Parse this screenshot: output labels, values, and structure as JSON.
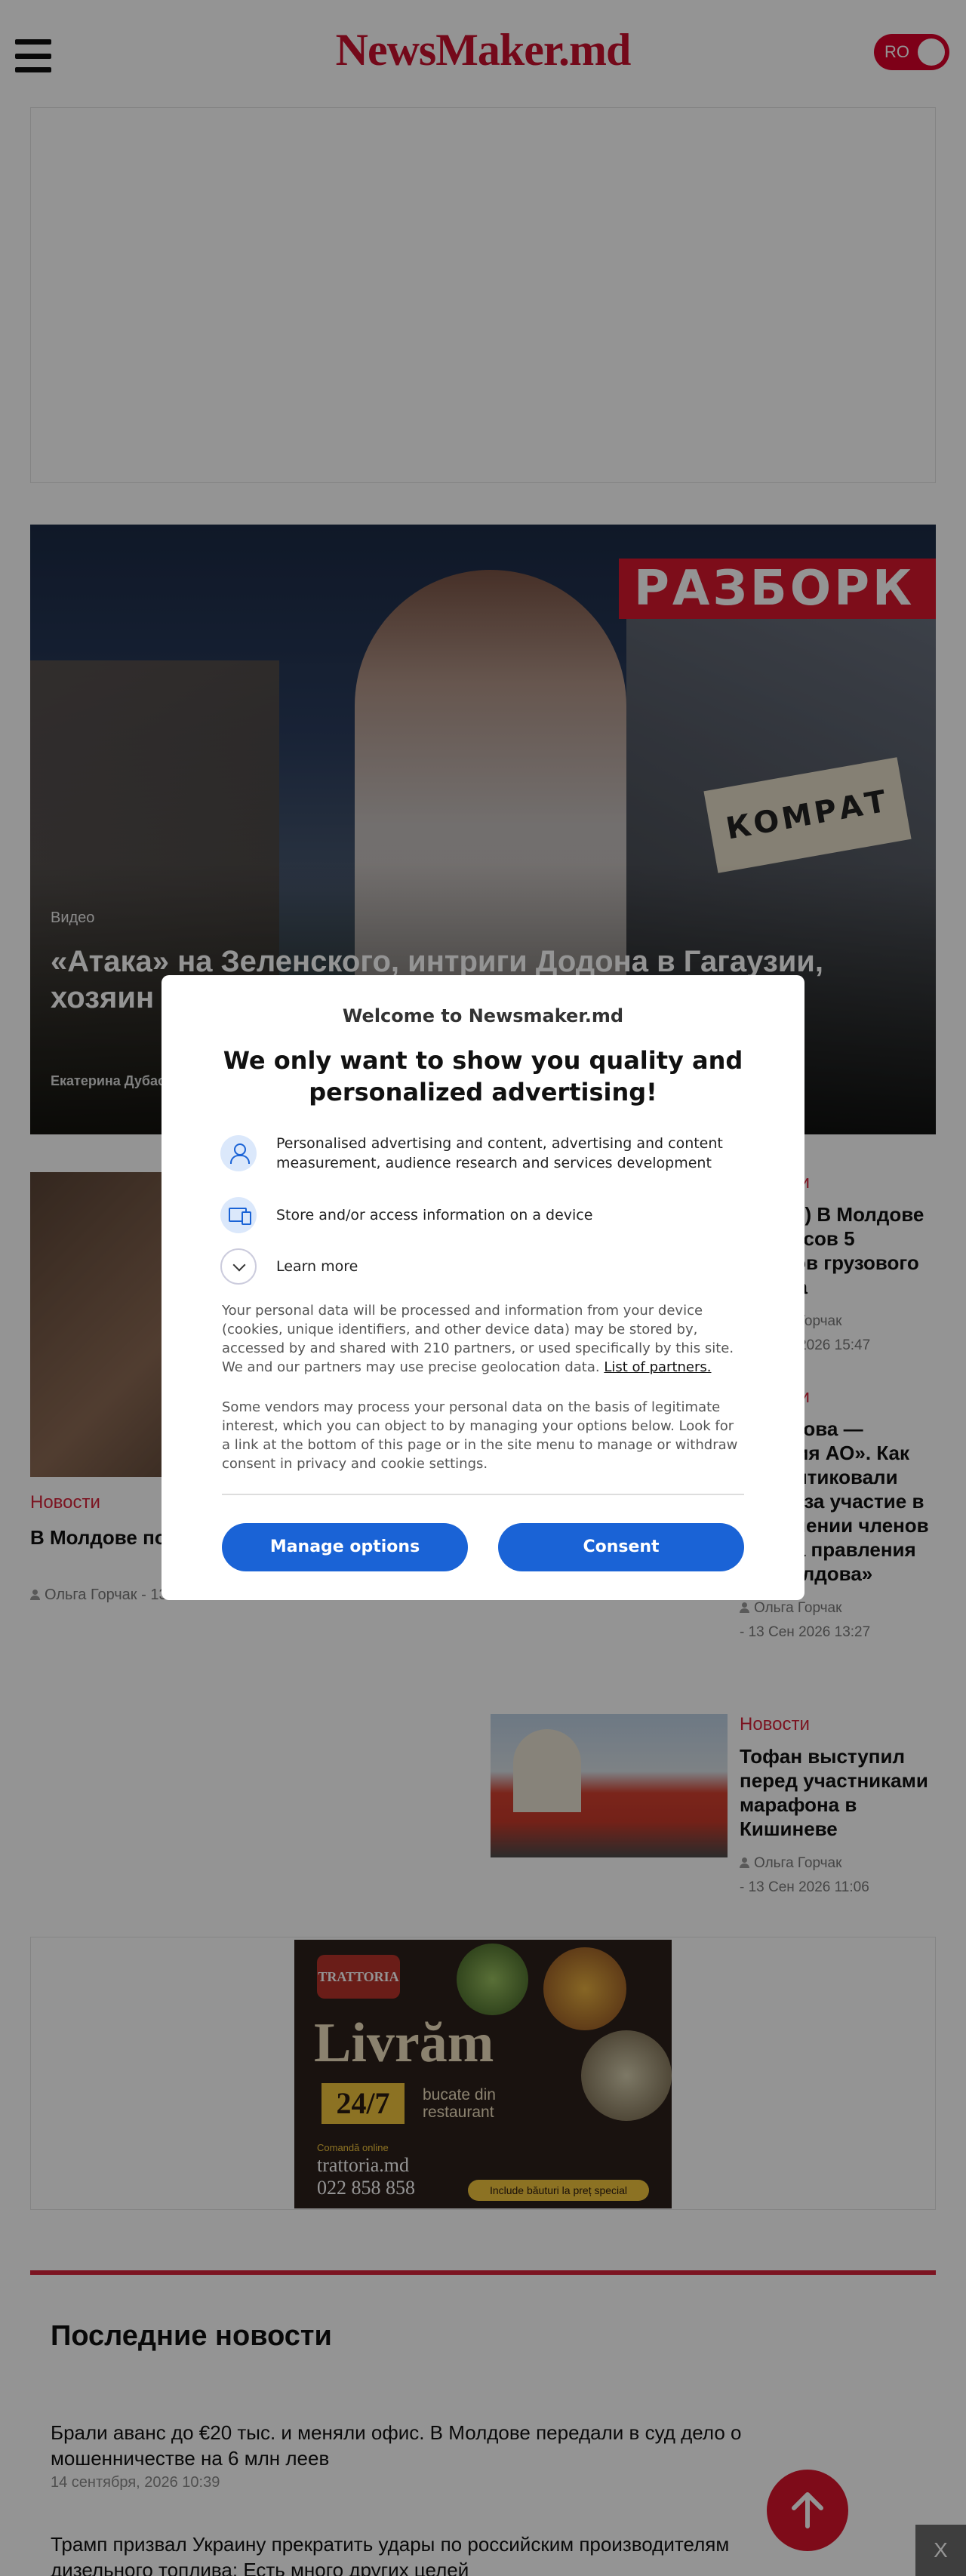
{
  "header": {
    "logo": "NewsMaker.md",
    "language": "RO"
  },
  "hero": {
    "category": "Видео",
    "title": "«Атака» на Зеленского, интриги Додона в Гагаузии, хозяин Приднестровья и «Гриппинг» Екатерины",
    "author": "Екатерина Дубасова",
    "banner_text": "РАЗБОРК",
    "sign_text": "КОМРАТ"
  },
  "news_left": {
    "category": "Новости",
    "title": "В Молдове по... предстоящую...",
    "author": "Ольга Горчак",
    "date": "13 Сен 2026 14:33"
  },
  "news_right": [
    {
      "category": "Новости",
      "title": "(ФОТО) В Молдове с рельсов 5 вагонов грузового поезда",
      "author": "Ольга Горчак",
      "date": "- 13 Сен 2026 15:47"
    },
    {
      "category": "Новости",
      "title": "«Молдова — Энергия АО». Как раскритиковали Центр за участие в назначении членов совета правления АО Молдова»",
      "author": "Ольга Горчак",
      "date": "- 13 Сен 2026 13:27"
    },
    {
      "category": "Новости",
      "title": "Тофан выступил перед участниками марафона в Кишиневе",
      "author": "Ольга Горчак",
      "date": "- 13 Сен 2026 11:06"
    }
  ],
  "ad": {
    "brand": "TRATTORIA",
    "headline": "Livrăm",
    "hours": "24/7",
    "sub": "bucate din restaurant",
    "order_label": "Comandă online",
    "site": "trattoria.md",
    "phone": "022 858 858",
    "promo": "Include băuturi la preț special"
  },
  "latest": {
    "heading": "Последние новости",
    "items": [
      {
        "title": "Брали аванс до €20 тыс. и меняли офис. В Молдове передали в суд дело о мошенничестве на 6 млн леев",
        "date": "14 сентября, 2026 10:39"
      },
      {
        "title": "Трамп призвал Украину прекратить удары по российским производителям дизельного топлива: Есть много других целей",
        "date": ""
      }
    ]
  },
  "close_label": "X",
  "consent": {
    "welcome": "Welcome to Newsmaker.md",
    "headline": "We only want to show you quality and personalized advertising!",
    "purposes": [
      {
        "icon": "user-icon",
        "label": "Personalised advertising and content, advertising and content measurement, audience research and services development"
      },
      {
        "icon": "device-icon",
        "label": "Store and/or access information on a device"
      },
      {
        "icon": "chevron-down-icon",
        "label": "Learn more"
      }
    ],
    "para1": "Your personal data will be processed and information from your device (cookies, unique identifiers, and other device data) may be stored by, accessed by and shared with 210 partners, or used specifically by this site. We and our partners may use precise geolocation data.",
    "partners_link": "List of partners.",
    "para2": "Some vendors may process your personal data on the basis of legitimate interest, which you can object to by managing your options below. Look for a link at the bottom of this page or in the site menu to manage or withdraw consent in privacy and cookie settings.",
    "manage_label": "Manage options",
    "consent_label": "Consent",
    "accent": "#1a63d6"
  },
  "colors": {
    "brand_red": "#c8102e",
    "category_red": "#d6243a"
  }
}
